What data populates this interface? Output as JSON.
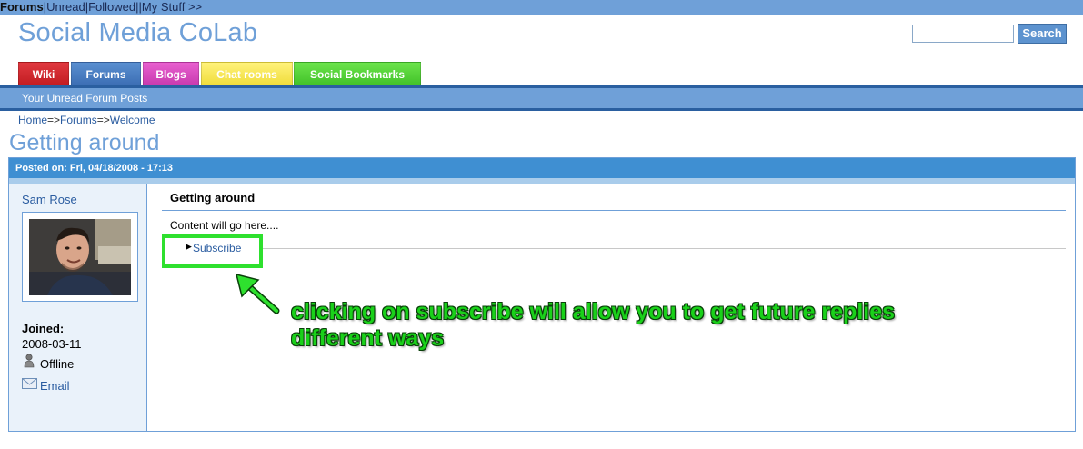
{
  "topbar": {
    "forums": "Forums",
    "sep1": "|",
    "unread": "Unread",
    "sep2": "|",
    "followed": "Followed",
    "sep3": "||",
    "my_stuff": "My Stuff >>"
  },
  "site": {
    "title": "Social Media CoLab"
  },
  "search": {
    "value": "",
    "button_label": "Search"
  },
  "tabs": [
    {
      "label": "Wiki",
      "color": "#d0262c"
    },
    {
      "label": "Forums",
      "color": "#4a7fc4"
    },
    {
      "label": "Blogs",
      "color": "#dc4cc1"
    },
    {
      "label": "Chat rooms",
      "color": "#f7e85a"
    },
    {
      "label": "Social Bookmarks",
      "color": "#53d336"
    }
  ],
  "subnav": {
    "label": "Your Unread Forum Posts"
  },
  "breadcrumb": {
    "home": "Home",
    "sep1": "=>",
    "forums": "Forums",
    "sep2": "=>",
    "welcome": "Welcome"
  },
  "page": {
    "title": "Getting around"
  },
  "post": {
    "posted_on": "Posted on: Fri, 04/18/2008 - 17:13",
    "title": "Getting around",
    "content": "Content will go here....",
    "subscribe_label": "Subscribe"
  },
  "author": {
    "name": "Sam Rose",
    "joined_label": "Joined:",
    "joined_date": "2008-03-11",
    "status": "Offline",
    "email_label": "Email"
  },
  "annotation": {
    "line1": "clicking on subscribe will allow you to get future replies",
    "line2": "different ways",
    "color": "#1ad11a"
  }
}
